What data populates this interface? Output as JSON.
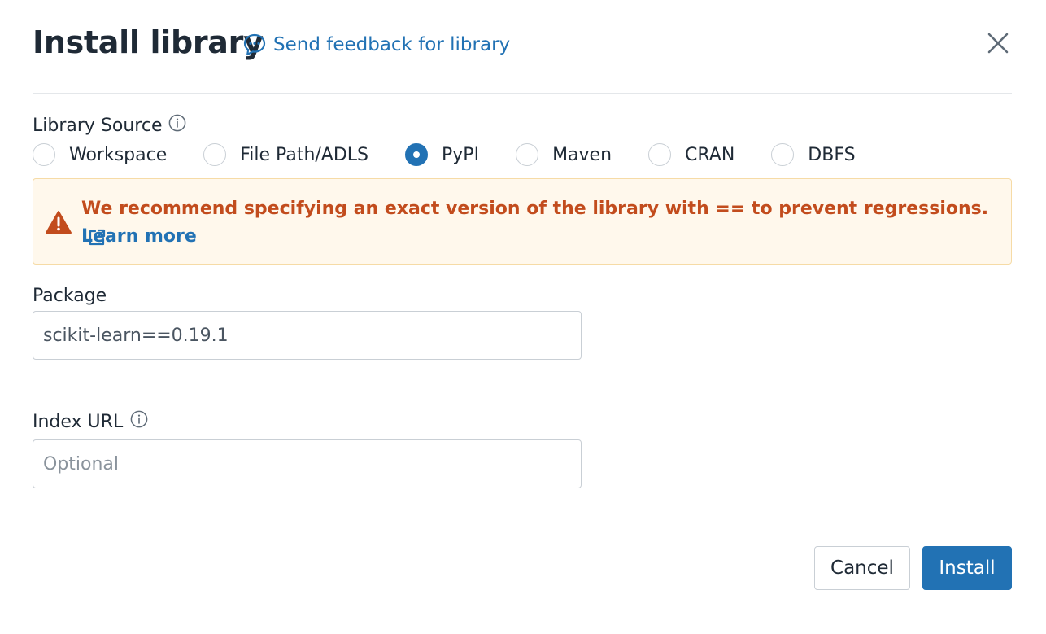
{
  "dialog": {
    "title": "Install library",
    "feedback_link": "Send feedback for library",
    "close_icon": "close-icon"
  },
  "library_source": {
    "label": "Library Source",
    "info_icon": "info-icon",
    "options": [
      {
        "label": "Workspace",
        "checked": false
      },
      {
        "label": "File Path/ADLS",
        "checked": false
      },
      {
        "label": "PyPI",
        "checked": true
      },
      {
        "label": "Maven",
        "checked": false
      },
      {
        "label": "CRAN",
        "checked": false
      },
      {
        "label": "DBFS",
        "checked": false
      }
    ]
  },
  "alert": {
    "icon": "warning-icon",
    "message": "We recommend specifying an exact version of the library with == to prevent regressions.",
    "link_text": "Learn more",
    "link_icon": "external-link-icon"
  },
  "package": {
    "label": "Package",
    "value": "scikit-learn==0.19.1"
  },
  "index_url": {
    "label": "Index URL",
    "info_icon": "info-icon",
    "placeholder": "Optional",
    "value": ""
  },
  "footer": {
    "cancel_label": "Cancel",
    "install_label": "Install"
  },
  "colors": {
    "accent": "#2272b4",
    "warning_text": "#c24c1d",
    "warning_background": "#fff8ec",
    "warning_border": "#f6dba6"
  }
}
